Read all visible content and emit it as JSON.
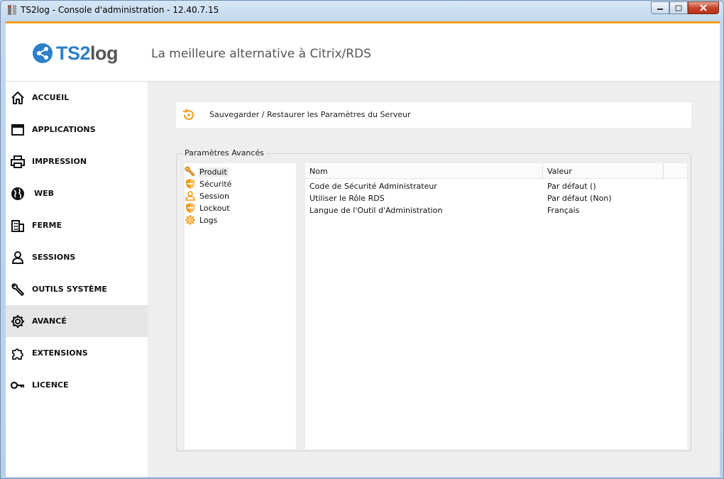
{
  "window": {
    "title": "TS2log - Console d'administration - 12.40.7.15"
  },
  "header": {
    "logo_text_1": "TS2",
    "logo_text_2": "log",
    "tagline": "La meilleure alternative à Citrix/RDS"
  },
  "sidebar": {
    "items": [
      {
        "label": "ACCUEIL",
        "icon": "home-icon"
      },
      {
        "label": "APPLICATIONS",
        "icon": "window-icon"
      },
      {
        "label": "IMPRESSION",
        "icon": "printer-icon"
      },
      {
        "label": "WEB",
        "icon": "globe-icon"
      },
      {
        "label": "FERME",
        "icon": "building-icon"
      },
      {
        "label": "SESSIONS",
        "icon": "user-icon"
      },
      {
        "label": "OUTILS SYSTÈME",
        "icon": "wrench-icon"
      },
      {
        "label": "AVANCÉ",
        "icon": "gear-icon",
        "active": true
      },
      {
        "label": "EXTENSIONS",
        "icon": "puzzle-icon"
      },
      {
        "label": "LICENCE",
        "icon": "key-icon"
      }
    ]
  },
  "main": {
    "backup_label": "Sauvegarder / Restaurer les Paramètres du Serveur",
    "group_title": "Paramètres Avancés",
    "tree": [
      {
        "label": "Produit",
        "icon": "wrench-icon",
        "selected": true
      },
      {
        "label": "Sécurité",
        "icon": "shield-icon"
      },
      {
        "label": "Session",
        "icon": "user-icon"
      },
      {
        "label": "Lockout",
        "icon": "shield-icon"
      },
      {
        "label": "Logs",
        "icon": "gear-icon"
      }
    ],
    "grid": {
      "columns": [
        "Nom",
        "Valeur"
      ],
      "rows": [
        {
          "name": "Code de Sécurité Administrateur",
          "value": "Par défaut ()"
        },
        {
          "name": "Utiliser le Rôle RDS",
          "value": "Par défaut (Non)"
        },
        {
          "name": "Langue de l'Outil d'Administration",
          "value": "Français"
        }
      ]
    }
  },
  "colors": {
    "accent": "#f29b15",
    "brand_blue": "#2c80c8",
    "sidebar_active": "#e6e6e6",
    "content_bg": "#eeeeee"
  }
}
